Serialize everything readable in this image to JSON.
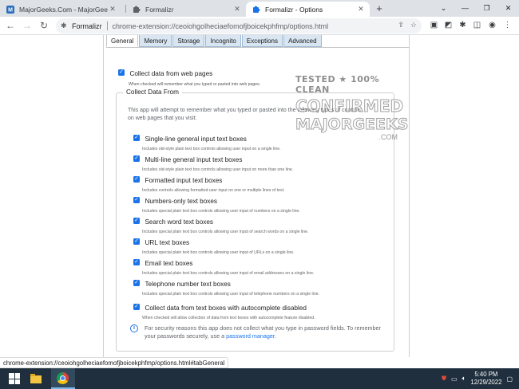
{
  "browser": {
    "tabs": [
      {
        "title": "MajorGeeks.Com - MajorGeeks",
        "icon": "majorgeeks-favicon-icon",
        "active": false
      },
      {
        "title": "Formalizr",
        "icon": "puzzle-favicon-icon",
        "active": false
      },
      {
        "title": "Formalizr - Options",
        "icon": "puzzle-favicon-icon",
        "active": true
      }
    ],
    "origin": "Formalizr",
    "url": "chrome-extension://ceoiohgolheciaefomofjboicekphfmp/options.html"
  },
  "options": {
    "tabs": [
      "General",
      "Memory",
      "Storage",
      "Incognito",
      "Exceptions",
      "Advanced"
    ],
    "active_tab": "General",
    "collect": {
      "label": "Collect data from web pages",
      "desc": "When checked will remember what you typed or pasted into web pages.",
      "checked": true
    },
    "section": {
      "legend": "Collect Data From",
      "intro": "This app will attempt to remember what you typed or pasted into the following types of controls on web pages that you visit:",
      "items": [
        {
          "label": "Single-line general input text boxes",
          "desc": "Includes old-style plain text box controls allowing user input on a single line.",
          "checked": true
        },
        {
          "label": "Multi-line general input text boxes",
          "desc": "Includes old-style plain text box controls allowing user input on more than one line.",
          "checked": true
        },
        {
          "label": "Formatted input text boxes",
          "desc": "Includes controls allowing formatted user input on one or multiple lines of text.",
          "checked": true
        },
        {
          "label": "Numbers-only text boxes",
          "desc": "Includes special plain text box controls allowing user input of numbers on a single line.",
          "checked": true
        },
        {
          "label": "Search word text boxes",
          "desc": "Includes special plain text box controls allowing user input of search words on a single line.",
          "checked": true
        },
        {
          "label": "URL text boxes",
          "desc": "Includes special plain text box controls allowing user input of URLs on a single line.",
          "checked": true
        },
        {
          "label": "Email text boxes",
          "desc": "Includes special plain text box controls allowing user input of email addresses on a single line.",
          "checked": true
        },
        {
          "label": "Telephone number text boxes",
          "desc": "Includes special plain text box controls allowing user input of telephone numbers on a single line.",
          "checked": true
        },
        {
          "label": "Collect data from text boxes with autocomplete disabled",
          "desc": "When checked will allow collection of data from text boxes with autocomplete feature disabled.",
          "checked": true
        }
      ],
      "note_text": "For security reasons this app does not collect what you type in password fields. To remember your passwords securely, use a ",
      "note_link": "password manager",
      "note_end": "."
    }
  },
  "watermark": {
    "line1": "TESTED ★ 100% CLEAN",
    "line2": "CONFIRMED",
    "line3": "MAJORGEEKS",
    "line4": ".COM"
  },
  "status_url": "chrome-extension://ceoiohgolheciaefomofjboicekphfmp/options.html#tabGeneral",
  "taskbar": {
    "time": "5:40 PM",
    "date": "12/29/2022"
  }
}
